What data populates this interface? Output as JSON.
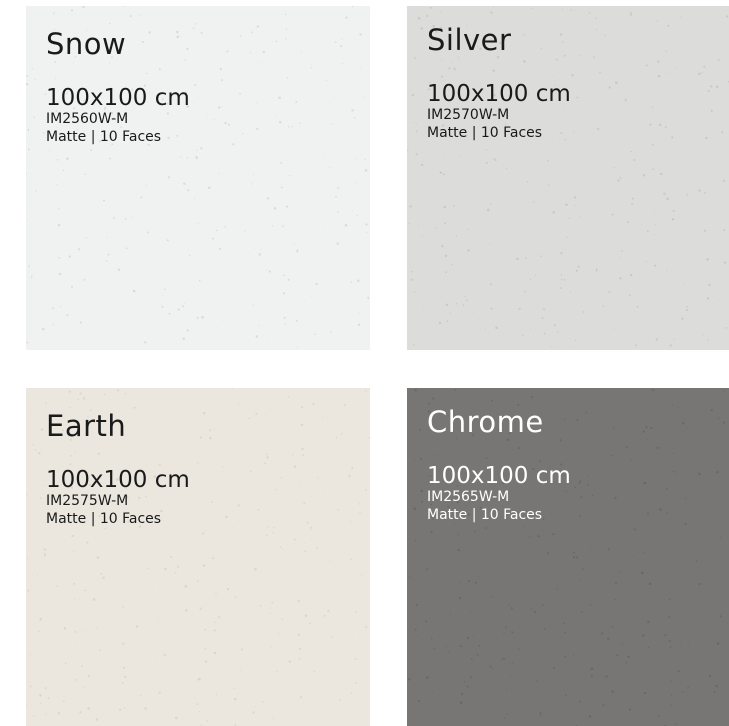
{
  "tiles": [
    {
      "name": "Snow",
      "size": "100x100 cm",
      "code": "IM2560W-M",
      "finish": "Matte  |  10 Faces",
      "bg": "#f0f1f1",
      "fg": "#1a1a1a",
      "speck": "#c9c9c9"
    },
    {
      "name": "Silver",
      "size": "100x100 cm",
      "code": "IM2570W-M",
      "finish": "Matte  |  10 Faces",
      "bg": "#dcdcda",
      "fg": "#1a1a1a",
      "speck": "#b9b9b6"
    },
    {
      "name": "Earth",
      "size": "100x100 cm",
      "code": "IM2575W-M",
      "finish": "Matte  |  10 Faces",
      "bg": "#ebe7de",
      "fg": "#1a1a1a",
      "speck": "#cfc9bd"
    },
    {
      "name": "Chrome",
      "size": "100x100 cm",
      "code": "IM2565W-M",
      "finish": "Matte  |  10 Faces",
      "bg": "#787674",
      "fg": "#ffffff",
      "speck": "#5f5d5b"
    }
  ]
}
